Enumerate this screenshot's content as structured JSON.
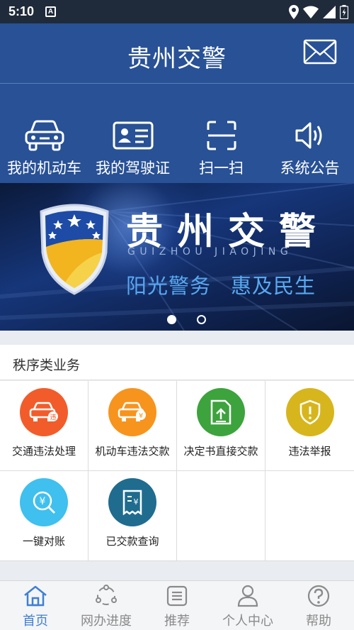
{
  "status_bar": {
    "time": "5:10",
    "notification_letter": "A"
  },
  "header": {
    "title": "贵州交警",
    "message_icon": "mail-icon"
  },
  "quick_nav": [
    {
      "label": "我的机动车",
      "icon": "car-icon"
    },
    {
      "label": "我的驾驶证",
      "icon": "license-card-icon"
    },
    {
      "label": "扫一扫",
      "icon": "scan-icon"
    },
    {
      "label": "系统公告",
      "icon": "speaker-icon"
    }
  ],
  "banner": {
    "title": "贵州交警",
    "pinyin": "GUIZHOU JIAOJING",
    "slogan_1": "阳光警务",
    "slogan_2": "惠及民生",
    "slide_count": 2,
    "active_slide": 1
  },
  "section": {
    "title": "秩序类业务",
    "items": [
      {
        "label": "交通违法处理",
        "icon": "car-violation-icon",
        "color": "#f25c2a"
      },
      {
        "label": "机动车违法交款",
        "icon": "car-payment-icon",
        "color": "#f7941d"
      },
      {
        "label": "决定书直接交款",
        "icon": "document-upload-icon",
        "color": "#3da33d"
      },
      {
        "label": "违法举报",
        "icon": "shield-alert-icon",
        "color": "#d7b61d"
      },
      {
        "label": "一键对账",
        "icon": "yuan-search-icon",
        "color": "#3fc0ee"
      },
      {
        "label": "已交款查询",
        "icon": "receipt-icon",
        "color": "#1f6c8f"
      }
    ]
  },
  "tab_bar": [
    {
      "label": "首页",
      "icon": "home-icon",
      "active": true
    },
    {
      "label": "网办进度",
      "icon": "progress-icon",
      "active": false
    },
    {
      "label": "推荐",
      "icon": "list-icon",
      "active": false
    },
    {
      "label": "个人中心",
      "icon": "user-icon",
      "active": false
    },
    {
      "label": "帮助",
      "icon": "help-icon",
      "active": false
    }
  ],
  "colors": {
    "primary": "#285196",
    "accent": "#3f7fd3",
    "status_bar": "#1f2a3a"
  }
}
